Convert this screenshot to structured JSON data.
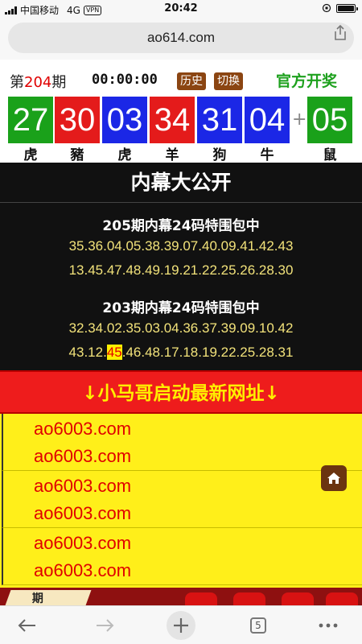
{
  "status": {
    "carrier": "中国移动",
    "network": "4G",
    "vpn": "VPN",
    "time": "20:42",
    "battery_level": 1.0
  },
  "browser": {
    "url": "ao614.com",
    "tabs_count": "5"
  },
  "lottery": {
    "period_prefix": "第",
    "period_number": "204",
    "period_suffix": "期",
    "countdown": "00:00:00",
    "history_label": "历史",
    "switch_label": "切换",
    "official_label": "官方开奖",
    "plus": "+",
    "balls": [
      {
        "number": "27",
        "zodiac": "虎",
        "color": "#1aa11a"
      },
      {
        "number": "30",
        "zodiac": "豬",
        "color": "#e41b1b"
      },
      {
        "number": "03",
        "zodiac": "虎",
        "color": "#1b27e6"
      },
      {
        "number": "34",
        "zodiac": "羊",
        "color": "#e41b1b"
      },
      {
        "number": "31",
        "zodiac": "狗",
        "color": "#1b27e6"
      },
      {
        "number": "04",
        "zodiac": "牛",
        "color": "#1b27e6"
      },
      {
        "number": "05",
        "zodiac": "鼠",
        "color": "#1aa11a"
      }
    ]
  },
  "insider": {
    "title": "内幕大公开",
    "blocks": [
      {
        "title": "205期内幕24码特围包中",
        "line1": "35.36.04.05.38.39.07.40.09.41.42.43",
        "line2": "13.45.47.48.49.19.21.22.25.26.28.30"
      },
      {
        "title": "203期内幕24码特围包中",
        "line1": "32.34.02.35.03.04.36.37.39.09.10.42",
        "line2_pre": "43.12.",
        "line2_hl": "45",
        "line2_post": ".46.48.17.18.19.22.25.28.31"
      }
    ]
  },
  "banner": {
    "text": "↓小马哥启动最新网址↓"
  },
  "links": [
    "ao6003.com",
    "ao6003.com",
    "ao6003.com",
    "ao6003.com",
    "ao6003.com",
    "ao6003.com"
  ],
  "strip": {
    "text": "期"
  },
  "icons": {
    "share": "share-icon",
    "home": "home-icon",
    "back": "arrow-left-icon",
    "forward": "arrow-right-icon",
    "new_tab": "plus-icon",
    "menu": "more-icon"
  },
  "colors": {
    "red": "#e41b1b",
    "blue": "#1b27e6",
    "green": "#1aa11a",
    "brown_button": "#8b4512",
    "banner_red": "#ee1c1c",
    "link_yellow": "#ffef1a",
    "number_yellow": "#f2e27a"
  }
}
